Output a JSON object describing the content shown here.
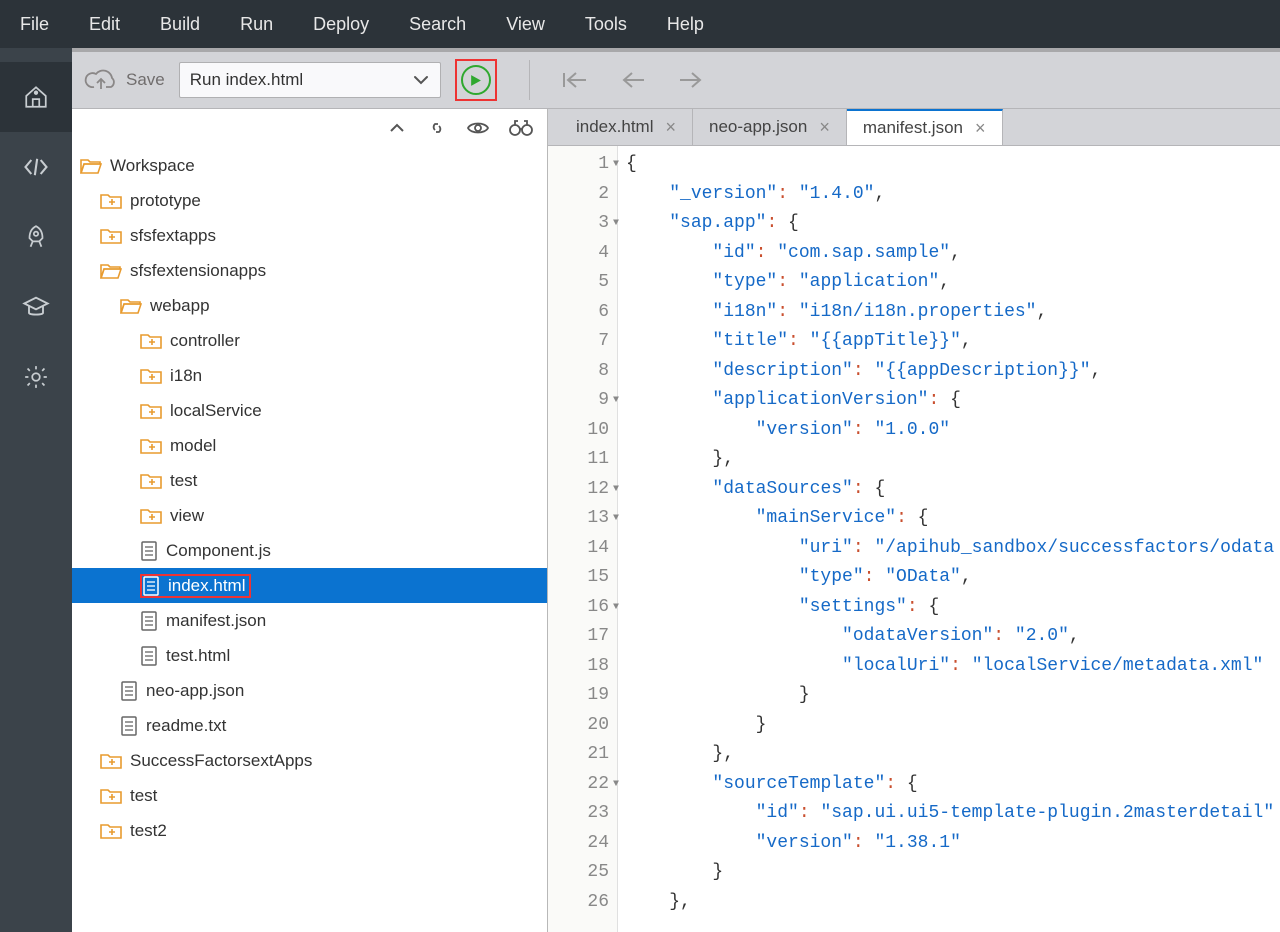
{
  "menubar": [
    "File",
    "Edit",
    "Build",
    "Run",
    "Deploy",
    "Search",
    "View",
    "Tools",
    "Help"
  ],
  "toolbar": {
    "save_label": "Save",
    "run_select": "Run index.html"
  },
  "activitybar": [
    "home",
    "code",
    "rocket",
    "graduation",
    "gear"
  ],
  "tree": [
    {
      "type": "folder-open",
      "label": "Workspace",
      "indent": 0
    },
    {
      "type": "folder-plus",
      "label": "prototype",
      "indent": 1
    },
    {
      "type": "folder-plus",
      "label": "sfsfextapps",
      "indent": 1
    },
    {
      "type": "folder-open",
      "label": "sfsfextensionapps",
      "indent": 1
    },
    {
      "type": "folder-open",
      "label": "webapp",
      "indent": 2
    },
    {
      "type": "folder-plus",
      "label": "controller",
      "indent": 3
    },
    {
      "type": "folder-plus",
      "label": "i18n",
      "indent": 3
    },
    {
      "type": "folder-plus",
      "label": "localService",
      "indent": 3
    },
    {
      "type": "folder-plus",
      "label": "model",
      "indent": 3
    },
    {
      "type": "folder-plus",
      "label": "test",
      "indent": 3
    },
    {
      "type": "folder-plus",
      "label": "view",
      "indent": 3
    },
    {
      "type": "file",
      "label": "Component.js",
      "indent": 3
    },
    {
      "type": "file",
      "label": "index.html",
      "indent": 3,
      "selected": true,
      "redbox": true
    },
    {
      "type": "file",
      "label": "manifest.json",
      "indent": 3
    },
    {
      "type": "file",
      "label": "test.html",
      "indent": 3
    },
    {
      "type": "file",
      "label": "neo-app.json",
      "indent": 2
    },
    {
      "type": "file",
      "label": "readme.txt",
      "indent": 2
    },
    {
      "type": "folder-plus",
      "label": "SuccessFactorsextApps",
      "indent": 1
    },
    {
      "type": "folder-plus",
      "label": "test",
      "indent": 1
    },
    {
      "type": "folder-plus",
      "label": "test2",
      "indent": 1
    }
  ],
  "tabs": [
    {
      "label": "index.html",
      "active": false
    },
    {
      "label": "neo-app.json",
      "active": false
    },
    {
      "label": "manifest.json",
      "active": true
    }
  ],
  "code": {
    "lines": [
      {
        "n": 1,
        "fold": true,
        "t": [
          [
            "{",
            "punc"
          ]
        ]
      },
      {
        "n": 2,
        "t": [
          [
            "    ",
            null
          ],
          [
            "\"_version\"",
            "str"
          ],
          [
            ": ",
            "op"
          ],
          [
            "\"1.4.0\"",
            "str"
          ],
          [
            ",",
            "punc"
          ]
        ]
      },
      {
        "n": 3,
        "fold": true,
        "t": [
          [
            "    ",
            null
          ],
          [
            "\"sap.app\"",
            "str"
          ],
          [
            ": ",
            "op"
          ],
          [
            "{",
            "punc"
          ]
        ]
      },
      {
        "n": 4,
        "t": [
          [
            "        ",
            null
          ],
          [
            "\"id\"",
            "str"
          ],
          [
            ": ",
            "op"
          ],
          [
            "\"com.sap.sample\"",
            "str"
          ],
          [
            ",",
            "punc"
          ]
        ]
      },
      {
        "n": 5,
        "t": [
          [
            "        ",
            null
          ],
          [
            "\"type\"",
            "str"
          ],
          [
            ": ",
            "op"
          ],
          [
            "\"application\"",
            "str"
          ],
          [
            ",",
            "punc"
          ]
        ]
      },
      {
        "n": 6,
        "t": [
          [
            "        ",
            null
          ],
          [
            "\"i18n\"",
            "str"
          ],
          [
            ": ",
            "op"
          ],
          [
            "\"i18n/i18n.properties\"",
            "str"
          ],
          [
            ",",
            "punc"
          ]
        ]
      },
      {
        "n": 7,
        "t": [
          [
            "        ",
            null
          ],
          [
            "\"title\"",
            "str"
          ],
          [
            ": ",
            "op"
          ],
          [
            "\"{{appTitle}}\"",
            "str"
          ],
          [
            ",",
            "punc"
          ]
        ]
      },
      {
        "n": 8,
        "t": [
          [
            "        ",
            null
          ],
          [
            "\"description\"",
            "str"
          ],
          [
            ": ",
            "op"
          ],
          [
            "\"{{appDescription}}\"",
            "str"
          ],
          [
            ",",
            "punc"
          ]
        ]
      },
      {
        "n": 9,
        "fold": true,
        "t": [
          [
            "        ",
            null
          ],
          [
            "\"applicationVersion\"",
            "str"
          ],
          [
            ": ",
            "op"
          ],
          [
            "{",
            "punc"
          ]
        ]
      },
      {
        "n": 10,
        "t": [
          [
            "            ",
            null
          ],
          [
            "\"version\"",
            "str"
          ],
          [
            ": ",
            "op"
          ],
          [
            "\"1.0.0\"",
            "str"
          ]
        ]
      },
      {
        "n": 11,
        "t": [
          [
            "        ",
            null
          ],
          [
            "},",
            "punc"
          ]
        ]
      },
      {
        "n": 12,
        "fold": true,
        "t": [
          [
            "        ",
            null
          ],
          [
            "\"dataSources\"",
            "str"
          ],
          [
            ": ",
            "op"
          ],
          [
            "{",
            "punc"
          ]
        ]
      },
      {
        "n": 13,
        "fold": true,
        "t": [
          [
            "            ",
            null
          ],
          [
            "\"mainService\"",
            "str"
          ],
          [
            ": ",
            "op"
          ],
          [
            "{",
            "punc"
          ]
        ]
      },
      {
        "n": 14,
        "t": [
          [
            "                ",
            null
          ],
          [
            "\"uri\"",
            "str"
          ],
          [
            ": ",
            "op"
          ],
          [
            "\"/apihub_sandbox/successfactors/odata",
            "str"
          ]
        ]
      },
      {
        "n": 15,
        "t": [
          [
            "                ",
            null
          ],
          [
            "\"type\"",
            "str"
          ],
          [
            ": ",
            "op"
          ],
          [
            "\"OData\"",
            "str"
          ],
          [
            ",",
            "punc"
          ]
        ]
      },
      {
        "n": 16,
        "fold": true,
        "t": [
          [
            "                ",
            null
          ],
          [
            "\"settings\"",
            "str"
          ],
          [
            ": ",
            "op"
          ],
          [
            "{",
            "punc"
          ]
        ]
      },
      {
        "n": 17,
        "t": [
          [
            "                    ",
            null
          ],
          [
            "\"odataVersion\"",
            "str"
          ],
          [
            ": ",
            "op"
          ],
          [
            "\"2.0\"",
            "str"
          ],
          [
            ",",
            "punc"
          ]
        ]
      },
      {
        "n": 18,
        "t": [
          [
            "                    ",
            null
          ],
          [
            "\"localUri\"",
            "str"
          ],
          [
            ": ",
            "op"
          ],
          [
            "\"localService/metadata.xml\"",
            "str"
          ]
        ]
      },
      {
        "n": 19,
        "t": [
          [
            "                ",
            null
          ],
          [
            "}",
            "punc"
          ]
        ]
      },
      {
        "n": 20,
        "t": [
          [
            "            ",
            null
          ],
          [
            "}",
            "punc"
          ]
        ]
      },
      {
        "n": 21,
        "t": [
          [
            "        ",
            null
          ],
          [
            "},",
            "punc"
          ]
        ]
      },
      {
        "n": 22,
        "fold": true,
        "t": [
          [
            "        ",
            null
          ],
          [
            "\"sourceTemplate\"",
            "str"
          ],
          [
            ": ",
            "op"
          ],
          [
            "{",
            "punc"
          ]
        ]
      },
      {
        "n": 23,
        "t": [
          [
            "            ",
            null
          ],
          [
            "\"id\"",
            "str"
          ],
          [
            ": ",
            "op"
          ],
          [
            "\"sap.ui.ui5-template-plugin.2masterdetail\"",
            "str"
          ]
        ]
      },
      {
        "n": 24,
        "t": [
          [
            "            ",
            null
          ],
          [
            "\"version\"",
            "str"
          ],
          [
            ": ",
            "op"
          ],
          [
            "\"1.38.1\"",
            "str"
          ]
        ]
      },
      {
        "n": 25,
        "t": [
          [
            "        ",
            null
          ],
          [
            "}",
            "punc"
          ]
        ]
      },
      {
        "n": 26,
        "t": [
          [
            "    ",
            null
          ],
          [
            "},",
            "punc"
          ]
        ]
      }
    ]
  }
}
